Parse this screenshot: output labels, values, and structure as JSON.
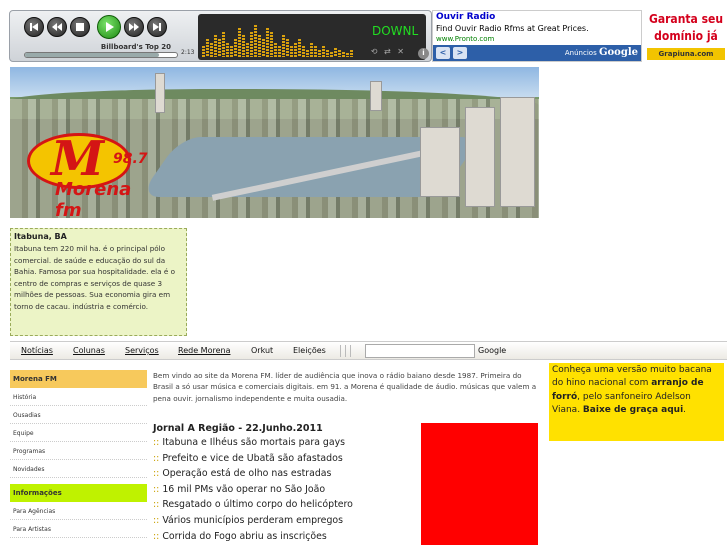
{
  "player": {
    "track": "Billboard's Top 20",
    "time": "2:13",
    "progress": 0.88,
    "scroll_text": "DOWNL",
    "eq_levels": [
      0.3,
      0.5,
      0.4,
      0.6,
      0.5,
      0.7,
      0.4,
      0.3,
      0.5,
      0.8,
      0.6,
      0.4,
      0.7,
      0.9,
      0.6,
      0.5,
      0.8,
      0.7,
      0.4,
      0.3,
      0.6,
      0.5,
      0.3,
      0.4,
      0.5,
      0.3,
      0.2,
      0.4,
      0.3,
      0.2,
      0.3,
      0.2,
      0.15,
      0.25,
      0.2,
      0.15,
      0.1,
      0.2
    ],
    "info": "i"
  },
  "ad": {
    "title": "Ouvir Radio",
    "text": "Find Ouvir Radio Rfms at Great Prices.",
    "url": "www.Pronto.com",
    "prev": "<",
    "next": ">",
    "label_prefix": "Anúncios",
    "label_brand": "Google"
  },
  "promo": {
    "line1": "Garanta seu",
    "line2": "domínio já",
    "sub": "Grapiuna.com"
  },
  "banner": {
    "logo_letter": "M",
    "logo_freq": "98.7",
    "logo_name": "Morena fm"
  },
  "info": {
    "title": "Itabuna, BA",
    "text": "Itabuna tem 220 mil ha. é o principal pólo comercial. de saúde e educação do sul da Bahia. Famosa por sua hospitalidade. ela é o centro de compras e serviços de quase 3 milhões de pessoas. Sua economia gira em torno de cacau. indústria e comércio."
  },
  "nav": {
    "items": [
      "Notícias",
      "Colunas",
      "Serviços",
      "Rede Morena",
      "Orkut",
      "Eleições"
    ],
    "search_placeholder": "",
    "google": "Google"
  },
  "sidebar": {
    "sections": [
      {
        "title": "Morena FM",
        "items": [
          "História",
          "Ousadias",
          "Equipe",
          "Programas",
          "Novidades"
        ]
      },
      {
        "title": "Informações",
        "items": [
          "Para Agências",
          "Para Artistas"
        ]
      }
    ]
  },
  "main": {
    "welcome": "Bem vindo ao site da Morena FM. líder de audiência que inova o rádio baiano desde 1987. Primeira do Brasil a só usar música e comerciais digitais. em 91. a Morena é qualidade de áudio. músicas que valem a pena ouvir. jornalismo independente e muita ousadia.",
    "jornal_title": "Jornal A Região - 22.Junho.2011",
    "bullet": "::",
    "news": [
      "Itabuna e Ilhéus são mortais para gays",
      "Prefeito e vice de Ubatã são afastados",
      "Operação está de olho nas estradas",
      "16 mil PMs vão operar no São João",
      "Resgatado o último corpo do helicóptero",
      "Vários municípios perderam empregos",
      "Corrida do Fogo abriu as inscrições"
    ]
  },
  "hino": {
    "part1": "Conheça uma versão muito bacana do hino nacional com ",
    "bold1": "arranjo de forró",
    "part2": ", pelo sanfoneiro Adelson Viana. ",
    "bold2": "Baixe de graça aqui",
    "part3": "."
  }
}
